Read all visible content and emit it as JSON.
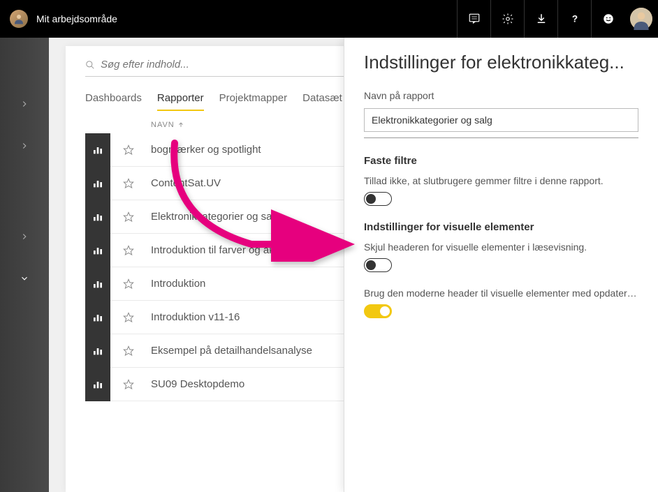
{
  "header": {
    "workspace": "Mit arbejdsområde"
  },
  "search": {
    "placeholder": "Søg efter indhold..."
  },
  "tabs": [
    {
      "label": "Dashboards",
      "active": false
    },
    {
      "label": "Rapporter",
      "active": true
    },
    {
      "label": "Projektmapper",
      "active": false
    },
    {
      "label": "Datasæt",
      "active": false
    }
  ],
  "columns": {
    "name": "NAVN"
  },
  "reports": [
    {
      "name": "bogmærker og spotlight"
    },
    {
      "name": "ContentSat.UV"
    },
    {
      "name": "Elektronikkategorier og salg"
    },
    {
      "name": "Introduktion til farver og akser"
    },
    {
      "name": "Introduktion"
    },
    {
      "name": "Introduktion v11-16"
    },
    {
      "name": "Eksempel på detailhandelsanalyse"
    },
    {
      "name": "SU09 Desktopdemo"
    }
  ],
  "pane": {
    "title": "Indstillinger for elektronikkateg...",
    "name_label": "Navn på rapport",
    "name_value": "Elektronikkategorier og salg",
    "filters_heading": "Faste filtre",
    "filters_text": "Tillad ikke, at slutbrugere gemmer filtre i denne rapport.",
    "visuals_heading": "Indstillinger for visuelle elementer",
    "visuals_text1": "Skjul headeren for visuelle elementer i læsevisning.",
    "visuals_text2": "Brug den moderne header til visuelle elementer med opdatered..."
  }
}
